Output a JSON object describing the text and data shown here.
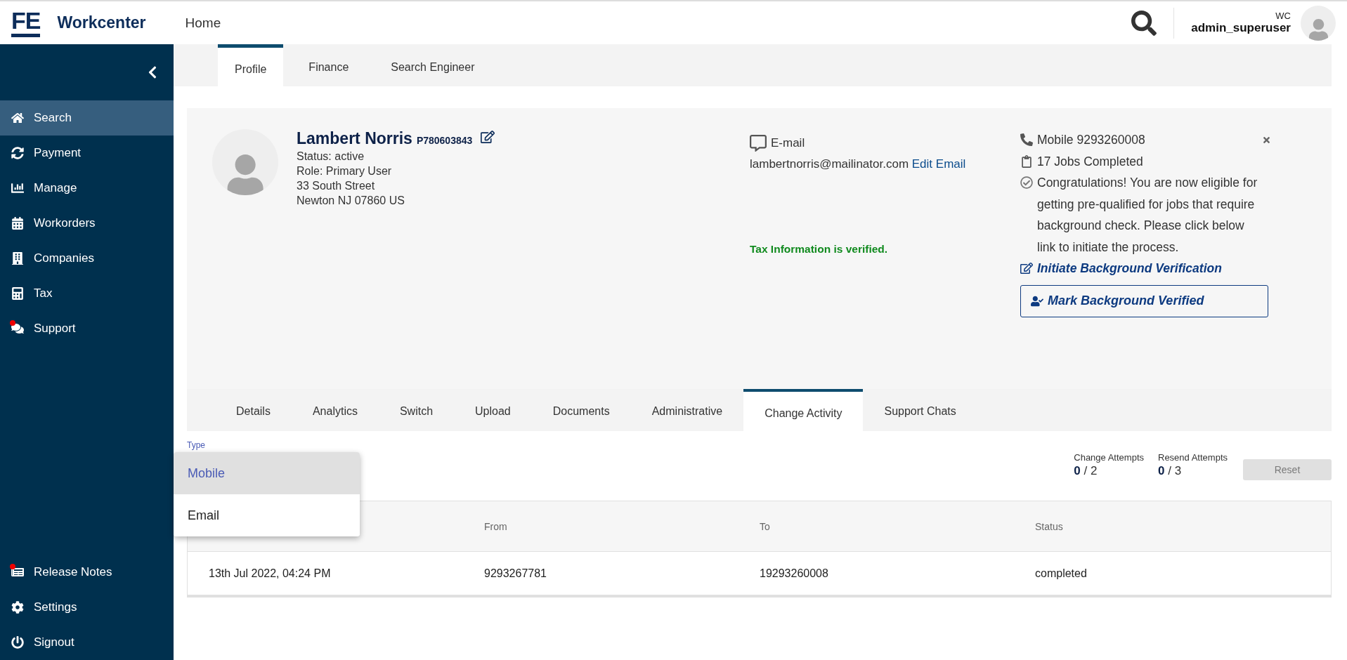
{
  "brand": {
    "logo": "FE",
    "name": "Workcenter"
  },
  "header": {
    "nav": "Home",
    "user_org": "WC",
    "username": "admin_superuser"
  },
  "sidebar": {
    "items": [
      {
        "label": "Search",
        "selected": true,
        "notification": false
      },
      {
        "label": "Payment",
        "selected": false,
        "notification": false
      },
      {
        "label": "Manage",
        "selected": false,
        "notification": false
      },
      {
        "label": "Workorders",
        "selected": false,
        "notification": false
      },
      {
        "label": "Companies",
        "selected": false,
        "notification": false
      },
      {
        "label": "Tax",
        "selected": false,
        "notification": false
      },
      {
        "label": "Support",
        "selected": false,
        "notification": true
      }
    ],
    "bottom_items": [
      {
        "label": "Release Notes",
        "selected": false,
        "notification": true
      },
      {
        "label": "Settings",
        "selected": false,
        "notification": false
      },
      {
        "label": "Signout",
        "selected": false,
        "notification": false
      }
    ]
  },
  "top_tabs": [
    {
      "label": "Profile",
      "selected": true
    },
    {
      "label": "Finance",
      "selected": false
    },
    {
      "label": "Search Engineer",
      "selected": false
    }
  ],
  "profile": {
    "name": "Lambert Norris",
    "id": "P780603843",
    "details": [
      "Status: active",
      "Role: Primary User",
      "33 South Street",
      "Newton NJ 07860 US"
    ],
    "email_label": "E-mail",
    "email": "lambertnorris@mailinator.com",
    "email_action": "Edit Email",
    "tax_status": "Tax Information is verified.",
    "mobile": "Mobile 9293260008",
    "jobs": "17 Jobs Completed",
    "message": "Congratulations! You are now eligible for getting pre-qualified for jobs that require background check. Please click below link to initiate the process.",
    "initiate_link": "Initiate Background Verification",
    "mark_button": "Mark Background Verified"
  },
  "sub_tabs": [
    {
      "label": "Details",
      "selected": false
    },
    {
      "label": "Analytics",
      "selected": false
    },
    {
      "label": "Switch",
      "selected": false
    },
    {
      "label": "Upload",
      "selected": false
    },
    {
      "label": "Documents",
      "selected": false
    },
    {
      "label": "Administrative",
      "selected": false
    },
    {
      "label": "Change Activity",
      "selected": true
    },
    {
      "label": "Support Chats",
      "selected": false
    }
  ],
  "change_activity": {
    "type_label": "Type",
    "options": [
      {
        "label": "Mobile",
        "selected": true
      },
      {
        "label": "Email",
        "selected": false
      }
    ],
    "attempts": [
      {
        "label": "Change Attempts",
        "used": "0",
        "total": "/ 2"
      },
      {
        "label": "Resend Attempts",
        "used": "0",
        "total": "/ 3"
      }
    ],
    "reset": {
      "label": "Reset",
      "disabled": true
    },
    "table": {
      "columns": [
        "From",
        "To",
        "Status"
      ],
      "rows": [
        {
          "date": "13th Jul 2022, 04:24 PM",
          "from": "9293267781",
          "to": "19293260008",
          "status": "completed"
        }
      ]
    }
  }
}
